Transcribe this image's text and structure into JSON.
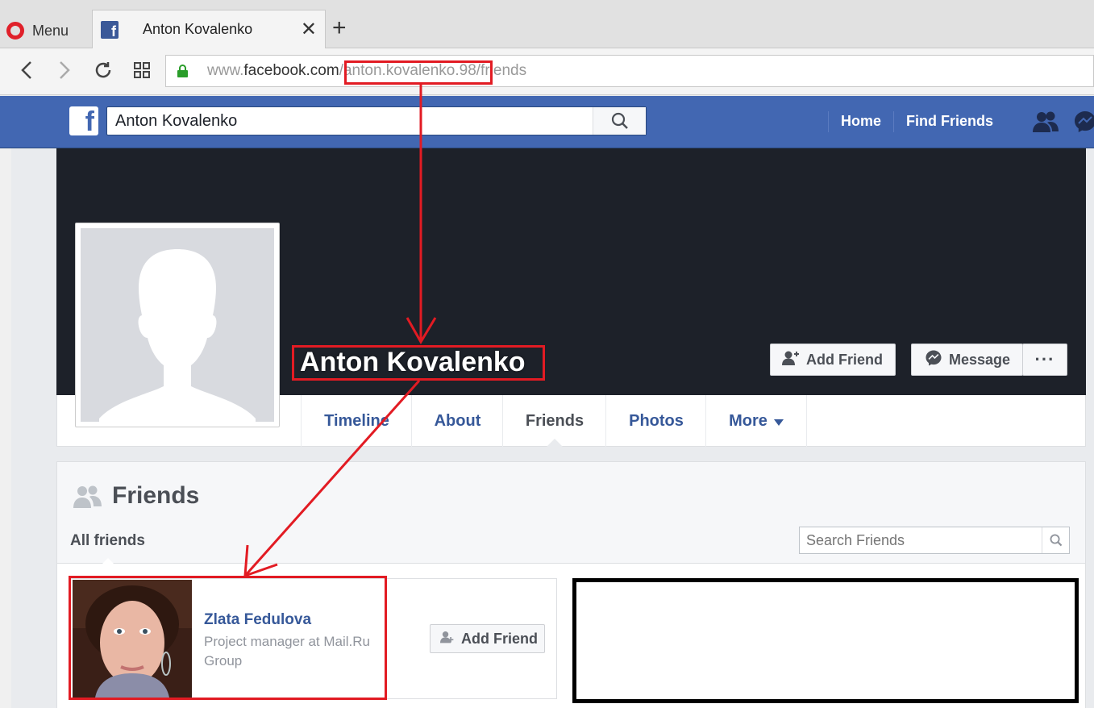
{
  "browser": {
    "menu_label": "Menu",
    "tab_title": "Anton Kovalenko",
    "tab_close": "✕",
    "new_tab": "+",
    "url_prefix": "www.facebook.com",
    "url_path": "/anton.kovalenko.98",
    "url_suffix": "/friends"
  },
  "fb_header": {
    "logo": "f",
    "search_value": "Anton Kovalenko",
    "nav": {
      "home": "Home",
      "find_friends": "Find Friends"
    }
  },
  "profile": {
    "name": "Anton Kovalenko",
    "add_friend_label": "Add Friend",
    "message_label": "Message",
    "more_dots": "···",
    "tabs": [
      "Timeline",
      "About",
      "Friends",
      "Photos",
      "More"
    ],
    "active_tab": "Friends"
  },
  "friends_section": {
    "title": "Friends",
    "filter_label": "All friends",
    "search_placeholder": "Search Friends",
    "friends": [
      {
        "name": "Zlata Fedulova",
        "description": "Project manager at Mail.Ru Group",
        "add_friend_label": "Add Friend"
      }
    ]
  },
  "colors": {
    "fb_blue": "#4267b2",
    "link_blue": "#365899",
    "cover_dark": "#1d2129",
    "annotation_red": "#e21b23",
    "ssl_green": "#2a9d2a"
  },
  "icons": {
    "opera": "opera-logo-icon",
    "facebook": "facebook-logo-icon",
    "search": "search-icon",
    "lock": "lock-icon",
    "friend_requests": "friend-requests-icon",
    "messenger": "messenger-icon"
  }
}
